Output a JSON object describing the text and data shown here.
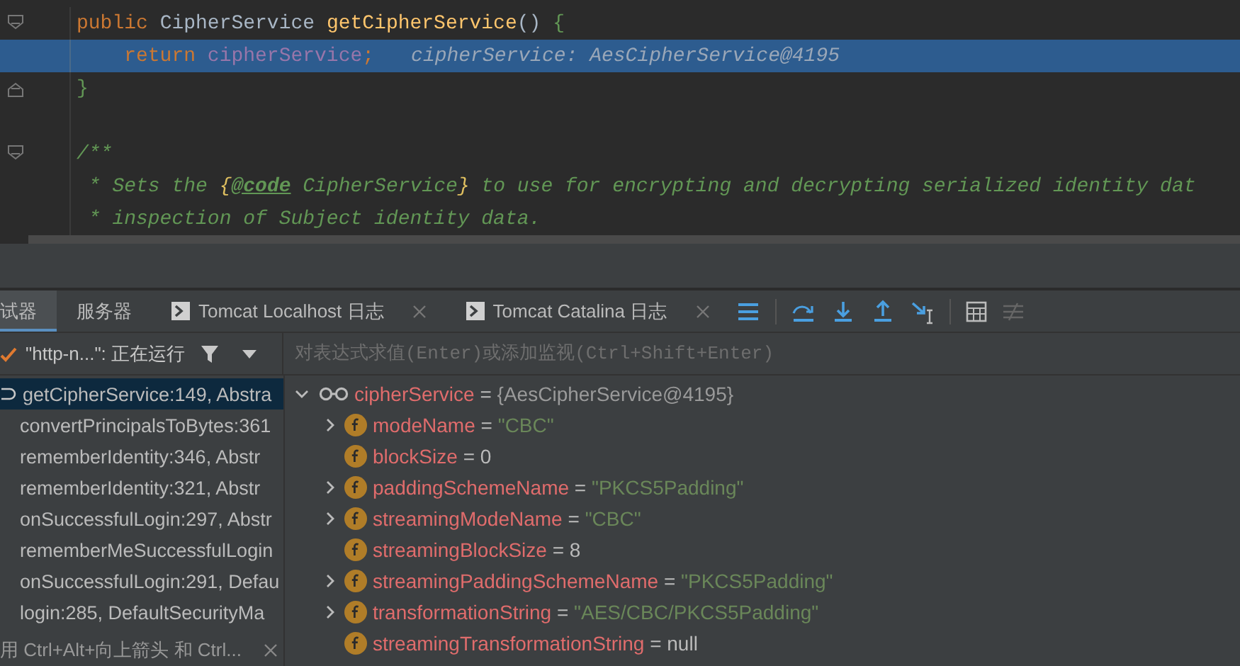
{
  "editor": {
    "lines": [
      {
        "kind": "fold_start",
        "highlighted": false,
        "tokens": [
          {
            "kind": "keyword",
            "text": "public "
          },
          {
            "kind": "plain",
            "text": "CipherService "
          },
          {
            "kind": "method",
            "text": "getCipherService"
          },
          {
            "kind": "paren",
            "text": "() "
          },
          {
            "kind": "brace",
            "text": "{"
          }
        ]
      },
      {
        "kind": "code",
        "highlighted": true,
        "tokens": [
          {
            "kind": "keyword",
            "text": "    return "
          },
          {
            "kind": "field",
            "text": "cipherService"
          },
          {
            "kind": "keyword",
            "text": ";"
          }
        ],
        "hint": "cipherService: AesCipherService@4195"
      },
      {
        "kind": "fold_end",
        "highlighted": false,
        "tokens": [
          {
            "kind": "brace",
            "text": "}"
          }
        ]
      },
      {
        "kind": "blank",
        "highlighted": false
      },
      {
        "kind": "fold_start",
        "highlighted": false,
        "tokens": [
          {
            "kind": "comment",
            "text": "/**"
          }
        ]
      },
      {
        "kind": "code",
        "highlighted": false,
        "tokens": [
          {
            "kind": "comment",
            "text": " * Sets the "
          },
          {
            "kind": "tag",
            "text": "{"
          },
          {
            "kind": "taglink",
            "text": "@code"
          },
          {
            "kind": "comment",
            "text": " CipherService"
          },
          {
            "kind": "tag",
            "text": "}"
          },
          {
            "kind": "comment",
            "text": " to use for encrypting and decrypting serialized identity dat"
          }
        ]
      },
      {
        "kind": "code",
        "highlighted": false,
        "tokens": [
          {
            "kind": "comment",
            "text": " * inspection of Subject identity data."
          }
        ]
      }
    ]
  },
  "tabs": [
    {
      "label": "试器",
      "kind": "plain",
      "selected": true
    },
    {
      "label": "服务器",
      "kind": "plain",
      "selected": false
    },
    {
      "label": "Tomcat Localhost 日志",
      "kind": "log",
      "selected": false
    },
    {
      "label": "Tomcat Catalina 日志",
      "kind": "log",
      "selected": false
    }
  ],
  "thread": {
    "label": "\"http-n...\": 正在运行"
  },
  "evaluate": {
    "placeholder": "对表达式求值(Enter)或添加监视(Ctrl+Shift+Enter)"
  },
  "frames": [
    {
      "text": "getCipherService:149, Abstra",
      "kind": "return",
      "selected": true
    },
    {
      "text": "convertPrincipalsToBytes:361",
      "kind": "frame",
      "selected": false
    },
    {
      "text": "rememberIdentity:346, Abstr",
      "kind": "frame",
      "selected": false
    },
    {
      "text": "rememberIdentity:321, Abstr",
      "kind": "frame",
      "selected": false
    },
    {
      "text": "onSuccessfulLogin:297, Abstr",
      "kind": "frame",
      "selected": false
    },
    {
      "text": "rememberMeSuccessfulLogin",
      "kind": "frame",
      "selected": false
    },
    {
      "text": "onSuccessfulLogin:291, Defau",
      "kind": "frame",
      "selected": false
    },
    {
      "text": "login:285, DefaultSecurityMa",
      "kind": "frame",
      "selected": false
    }
  ],
  "frames_hint": "用 Ctrl+Alt+向上箭头 和 Ctrl...",
  "variables": {
    "name": "cipherService",
    "separator": "=",
    "value": "{AesCipherService@4195}",
    "expanded": true,
    "children": [
      {
        "name": "modeName",
        "separator": "=",
        "value": "\"CBC\"",
        "kind": "string",
        "expandable": true
      },
      {
        "name": "blockSize",
        "separator": "=",
        "value": "0",
        "kind": "number",
        "expandable": false
      },
      {
        "name": "paddingSchemeName",
        "separator": "=",
        "value": "\"PKCS5Padding\"",
        "kind": "string",
        "expandable": true
      },
      {
        "name": "streamingModeName",
        "separator": "=",
        "value": "\"CBC\"",
        "kind": "string",
        "expandable": true
      },
      {
        "name": "streamingBlockSize",
        "separator": "=",
        "value": "8",
        "kind": "number",
        "expandable": false
      },
      {
        "name": "streamingPaddingSchemeName",
        "separator": "=",
        "value": "\"PKCS5Padding\"",
        "kind": "string",
        "expandable": true
      },
      {
        "name": "transformationString",
        "separator": "=",
        "value": "\"AES/CBC/PKCS5Padding\"",
        "kind": "string",
        "expandable": true
      },
      {
        "name": "streamingTransformationString",
        "separator": "=",
        "value": "null",
        "kind": "number",
        "expandable": false
      }
    ]
  }
}
